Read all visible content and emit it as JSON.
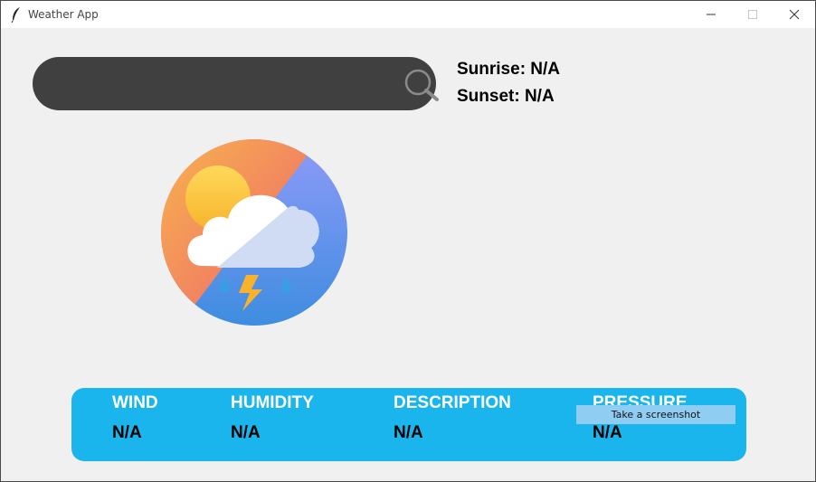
{
  "window": {
    "title": "Weather App"
  },
  "search": {
    "value": "",
    "placeholder": ""
  },
  "sun": {
    "sunrise": "Sunrise: N/A",
    "sunset": "Sunset: N/A"
  },
  "info": [
    {
      "label": "WIND",
      "value": "N/A"
    },
    {
      "label": "HUMIDITY",
      "value": "N/A"
    },
    {
      "label": "DESCRIPTION",
      "value": "N/A"
    },
    {
      "label": "PRESSURE",
      "value": "N/A"
    }
  ],
  "tooltip": {
    "text": "Take a screenshot"
  },
  "colors": {
    "info_bar": "#1ab5ec",
    "search_bar": "#404040",
    "background": "#f0f0f0"
  },
  "icons": {
    "app": "feather-icon",
    "search": "search-icon",
    "weather": "weather-storm-icon"
  }
}
